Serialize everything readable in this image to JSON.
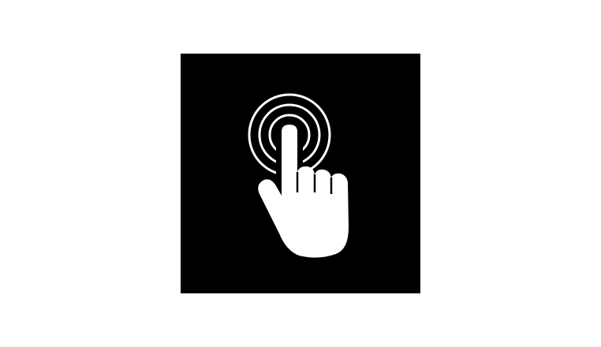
{
  "icon": {
    "name": "tap-gesture-icon",
    "description_glyph": "hand-pointer-with-touch-ripples"
  },
  "colors": {
    "page_background": "#ffffff",
    "tile_background": "#000000",
    "glyph": "#ffffff"
  }
}
